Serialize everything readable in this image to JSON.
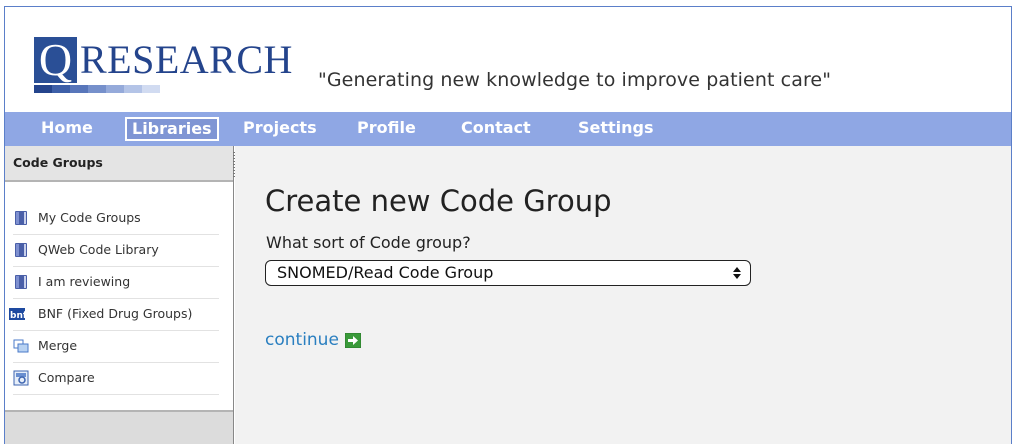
{
  "brand": {
    "logo_letter": "Q",
    "logo_word": "RESEARCH",
    "tagline": "\"Generating new knowledge to improve patient care\""
  },
  "nav": {
    "items": [
      {
        "label": "Home"
      },
      {
        "label": "Libraries",
        "active": true
      },
      {
        "label": "Projects"
      },
      {
        "label": "Profile"
      },
      {
        "label": "Contact"
      },
      {
        "label": "Settings"
      }
    ]
  },
  "sidebar": {
    "title": "Code Groups",
    "items": [
      {
        "label": "My Code Groups",
        "icon": "book-icon"
      },
      {
        "label": "QWeb Code Library",
        "icon": "book-icon"
      },
      {
        "label": "I am reviewing",
        "icon": "book-icon"
      },
      {
        "label": "BNF (Fixed Drug Groups)",
        "icon": "bnf-icon"
      },
      {
        "label": "Merge",
        "icon": "merge-icon"
      },
      {
        "label": "Compare",
        "icon": "compare-icon"
      }
    ]
  },
  "main": {
    "title": "Create new Code Group",
    "question": "What sort of Code group?",
    "select_value": "SNOMED/Read Code Group",
    "continue_label": "continue"
  },
  "colors": {
    "nav_bg": "#8fa7e4",
    "brand_blue": "#24448c",
    "link": "#2a7fc0"
  }
}
